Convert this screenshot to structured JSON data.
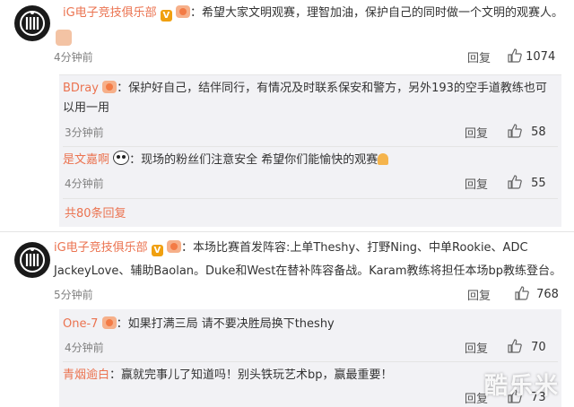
{
  "comments": [
    {
      "name": "iG电子竞技俱乐部",
      "text": "：希望大家文明观赛，理智加油，保护自己的同时做一个文明的观赛人。",
      "time": "4分钟前",
      "reply_label": "回复",
      "likes": "1074",
      "replies": [
        {
          "name": "BDray",
          "text_line1": "：保护好自己，结伴同行，有情况及时联系保安和警方，另外193的空手道教练也可",
          "text_line2": "以用一用",
          "time": "3分钟前",
          "reply_label": "回复",
          "likes": "58"
        },
        {
          "name": "是文嘉啊",
          "text": "：现场的粉丝们注意安全 希望你们能愉快的观赛",
          "time": "4分钟前",
          "reply_label": "回复",
          "likes": "55"
        }
      ],
      "more_replies": "共80条回复"
    },
    {
      "name": "iG电子竞技俱乐部",
      "text_line1": "：本场比赛首发阵容:上单Theshy、打野Ning、中单Rookie、ADC",
      "text_line2": "JackeyLove、辅助Baolan。Duke和West在替补阵容备战。Karam教练将担任本场bp教练登台。",
      "time": "5分钟前",
      "reply_label": "回复",
      "likes": "768",
      "replies": [
        {
          "name": "One-7",
          "text": "：如果打满三局 请不要决胜局换下theshy",
          "time": "4分钟前",
          "reply_label": "回复",
          "likes": "70"
        },
        {
          "name": "青烟逾白",
          "text": "：赢就完事儿了知道吗！别头铁玩艺术bp，赢最重要！",
          "reply_label": "回复",
          "likes": "73"
        }
      ]
    }
  ],
  "watermark": "酷乐米",
  "colors": {
    "name": "#eb7350",
    "sub_bg": "#f2f2f5",
    "gray": "#808080"
  },
  "icons": {
    "like": "thumb-up-icon",
    "avatar": "ig-logo-icon"
  }
}
